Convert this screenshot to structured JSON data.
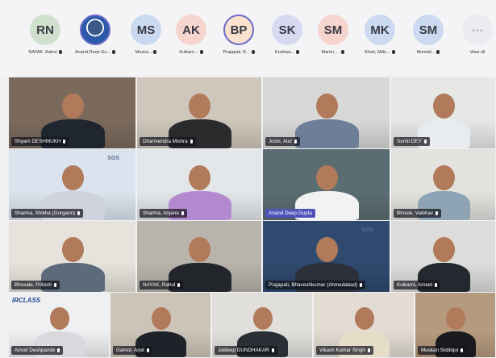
{
  "participants_strip": [
    {
      "initials": "RN",
      "name": "NAYAK, Rahul",
      "bg": "#cfe0cd"
    },
    {
      "initials": "",
      "name": "Anand Deep Gu...",
      "bg": "#2c5aa8",
      "photo": true
    },
    {
      "initials": "MS",
      "name": "Muska...",
      "bg": "#c9d9ef"
    },
    {
      "initials": "AK",
      "name": "Kulkarn...",
      "bg": "#f7d5cf"
    },
    {
      "initials": "BP",
      "name": "Prajapati, B...",
      "bg": "#fbe2cf",
      "ring": true
    },
    {
      "initials": "SK",
      "name": "Kushwa...",
      "bg": "#d7d9f1"
    },
    {
      "initials": "SM",
      "name": "Mantri, ...",
      "bg": "#f7d5cf"
    },
    {
      "initials": "MK",
      "name": "Khati, Milin...",
      "bg": "#cbdaf0"
    },
    {
      "initials": "SM",
      "name": "Mondal...",
      "bg": "#cbdaf0"
    },
    {
      "initials": "⋯",
      "name": "View all",
      "bg": "#ececf0",
      "more": true
    }
  ],
  "video_tiles": [
    {
      "name": "Shyam DESHMUKH",
      "bg": "#7b6a5c",
      "shirt": "#1f2630",
      "logo": ""
    },
    {
      "name": "Dharmendra Mishra",
      "bg": "#cfc7bb",
      "shirt": "#2b2b2e",
      "logo": ""
    },
    {
      "name": "Joshi, Atul",
      "bg": "#d8d9d7",
      "shirt": "#6d7e98",
      "logo": ""
    },
    {
      "name": "Sumit DEY",
      "bg": "#e7e8e6",
      "shirt": "#e9ecef",
      "logo": ""
    },
    {
      "name": "Sharma, Shikha (Gurgaon)",
      "bg": "#dbe4ee",
      "shirt": "#cfd3dd",
      "logo": "SGS"
    },
    {
      "name": "Sharma, Anjana",
      "bg": "#e4e7ea",
      "shirt": "#b38ad0",
      "logo": ""
    },
    {
      "name": "Anand Deep Gupta",
      "bg": "#5a6d72",
      "shirt": "#f2f2f2",
      "logo": "",
      "highlight": true
    },
    {
      "name": "Bhosle, Vaibhav",
      "bg": "#e3e2df",
      "shirt": "#8ea3b3",
      "logo": ""
    },
    {
      "name": "Bhosale, Pritesh",
      "bg": "#e6e3dc",
      "shirt": "#5c6a7a",
      "logo": ""
    },
    {
      "name": "NAYAK, Rahul",
      "bg": "#b8b4ab",
      "shirt": "#22262b",
      "logo": ""
    },
    {
      "name": "Prajapati, Bhaveshkumar (Ahmedabad)",
      "bg": "#2f4a6e",
      "shirt": "#2a2f3a",
      "logo": "SGS"
    },
    {
      "name": "Kulkarni, Ameet",
      "bg": "#dcdcda",
      "shirt": "#24282f",
      "logo": ""
    },
    {
      "name": "Amod Deshpande",
      "bg": "#eef0f2",
      "shirt": "#d7d9dc",
      "logo": "IRCLASS"
    },
    {
      "name": "Gamot, Arpit",
      "bg": "#ccc4b8",
      "shirt": "#1e2329",
      "logo": ""
    },
    {
      "name": "Jaldeep DUNDHAKAR",
      "bg": "#e1dfdb",
      "shirt": "#2a2e35",
      "logo": ""
    },
    {
      "name": "Vikash Kumar Singh",
      "bg": "#e2dcd2",
      "shirt": "#e6ddc9",
      "logo": ""
    },
    {
      "name": "Muskan Siddiqui",
      "bg": "#b59a7e",
      "shirt": "#1a1a1e",
      "logo": ""
    }
  ]
}
